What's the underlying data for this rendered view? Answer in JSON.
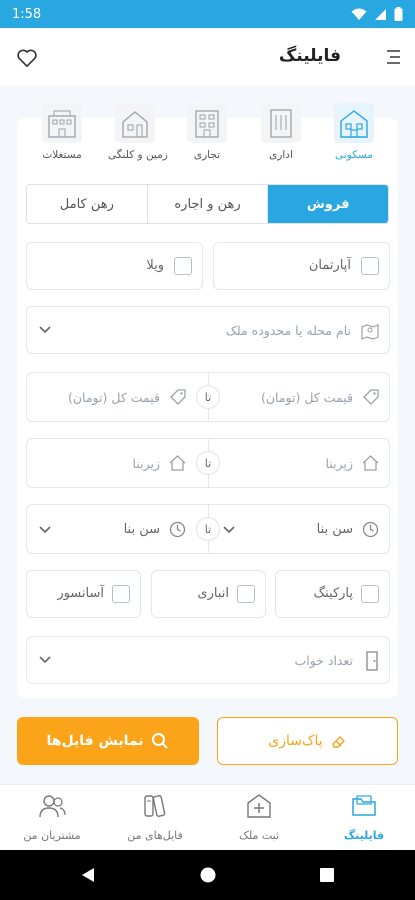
{
  "status": {
    "time": "1:58"
  },
  "header": {
    "title": "فایلینگ",
    "menu_icon": "menu-icon",
    "favorite_icon": "heart-icon"
  },
  "categories": [
    {
      "label": "مسکونی",
      "icon": "residential-icon",
      "active": true
    },
    {
      "label": "اداری",
      "icon": "office-icon",
      "active": false
    },
    {
      "label": "تجاری",
      "icon": "commercial-icon",
      "active": false
    },
    {
      "label": "زمین و کلنگی",
      "icon": "land-icon",
      "active": false
    },
    {
      "label": "مستغلات",
      "icon": "estate-icon",
      "active": false
    }
  ],
  "deal_tabs": [
    {
      "label": "فروش",
      "active": true
    },
    {
      "label": "رهن و اجاره",
      "active": false
    },
    {
      "label": "رهن کامل",
      "active": false
    }
  ],
  "property_types": {
    "apartment": "آپارتمان",
    "villa": "ویلا"
  },
  "location": {
    "placeholder": "نام محله یا محدوده ملک"
  },
  "price": {
    "from": "قیمت کل (تومان)",
    "to": "قیمت کل (تومان)",
    "separator": "تا"
  },
  "area": {
    "from": "زیربنا",
    "to": "زیربنا",
    "separator": "تا"
  },
  "age": {
    "from": "سن بنا",
    "to": "سن بنا",
    "separator": "تا"
  },
  "features": {
    "parking": "پارکینگ",
    "storage": "انباری",
    "elevator": "آسانسور"
  },
  "bedrooms": {
    "placeholder": "تعداد خواب"
  },
  "actions": {
    "clear": "پاک‌سازی",
    "show": "نمایش فایل‌ها"
  },
  "bottom_nav": [
    {
      "label": "فایلینگ",
      "icon": "folder-icon",
      "active": true
    },
    {
      "label": "ثبت ملک",
      "icon": "add-property-icon",
      "active": false
    },
    {
      "label": "فایل‌های من",
      "icon": "my-files-icon",
      "active": false
    },
    {
      "label": "مشتریان من",
      "icon": "customers-icon",
      "active": false
    }
  ],
  "colors": {
    "accent": "#29a7e1",
    "orange": "#fba41a",
    "background": "#f4f7fb"
  }
}
